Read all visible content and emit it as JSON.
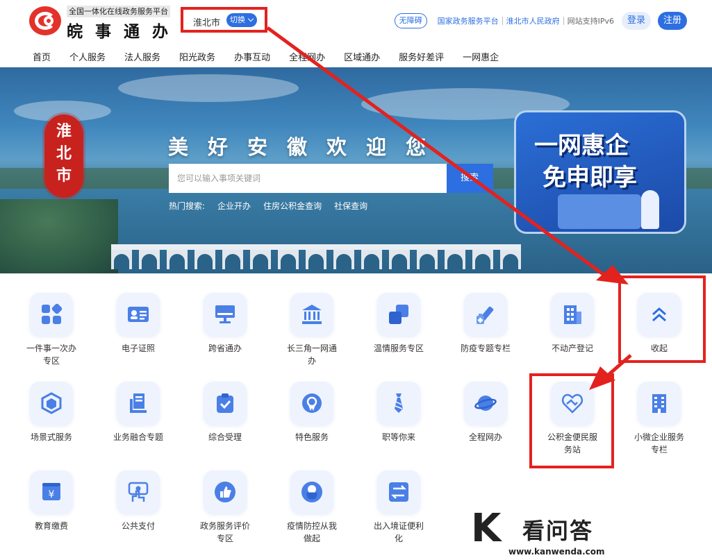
{
  "header": {
    "slogan": "全国一体化在线政务服务平台",
    "site_name": "皖事通办",
    "city": "淮北市",
    "switch_label": "切换",
    "accessibility": "无障碍",
    "links": [
      "国家政务服务平台",
      "淮北市人民政府"
    ],
    "ipv6": "网站支持IPv6",
    "login": "登录",
    "register": "注册"
  },
  "nav": [
    "首页",
    "个人服务",
    "法人服务",
    "阳光政务",
    "办事互动",
    "全程网办",
    "区域通办",
    "服务好差评",
    "一网惠企"
  ],
  "banner": {
    "seal_text": "淮北市",
    "welcome": "美好安徽欢迎您",
    "search_placeholder": "您可以输入事项关键词",
    "search_button": "搜索",
    "hot_label": "热门搜索:",
    "hot_items": [
      "企业开办",
      "住房公积金查询",
      "社保查询"
    ],
    "promo_line1": "一网惠企",
    "promo_line2": "免申即享"
  },
  "services": [
    {
      "label": "一件事一次办专区",
      "icon": "blocks-icon"
    },
    {
      "label": "电子证照",
      "icon": "id-card-icon"
    },
    {
      "label": "跨省通办",
      "icon": "monitor-icon"
    },
    {
      "label": "长三角一网通办",
      "icon": "government-building-icon"
    },
    {
      "label": "温情服务专区",
      "icon": "overlap-squares-icon"
    },
    {
      "label": "防疫专题专栏",
      "icon": "syringe-icon"
    },
    {
      "label": "不动产登记",
      "icon": "office-building-icon"
    },
    {
      "label": "收起",
      "icon": "chevron-up-double-icon"
    },
    {
      "label": "场景式服务",
      "icon": "cube-icon"
    },
    {
      "label": "业务融合专题",
      "icon": "documents-stack-icon"
    },
    {
      "label": "综合受理",
      "icon": "clipboard-check-icon"
    },
    {
      "label": "特色服务",
      "icon": "badge-icon"
    },
    {
      "label": "职等你来",
      "icon": "necktie-icon"
    },
    {
      "label": "全程网办",
      "icon": "planet-icon"
    },
    {
      "label": "公积金便民服务站",
      "icon": "handshake-heart-icon"
    },
    {
      "label": "小微企业服务专栏",
      "icon": "apartment-building-icon"
    },
    {
      "label": "教育缴费",
      "icon": "yuan-payment-icon"
    },
    {
      "label": "公共支付",
      "icon": "hand-payment-icon"
    },
    {
      "label": "政务服务评价专区",
      "icon": "thumbs-up-icon"
    },
    {
      "label": "疫情防控从我做起",
      "icon": "mask-icon"
    },
    {
      "label": "出入境证便利化",
      "icon": "exchange-arrows-icon"
    }
  ],
  "watermark": {
    "letter": "K",
    "text": "看问答",
    "url": "www.kanwenda.com"
  },
  "colors": {
    "brand_blue": "#2d6fe0",
    "annotation_red": "#e3221e",
    "tile_bg": "#eef3fd",
    "icon_blue": "#4a7fe6"
  }
}
